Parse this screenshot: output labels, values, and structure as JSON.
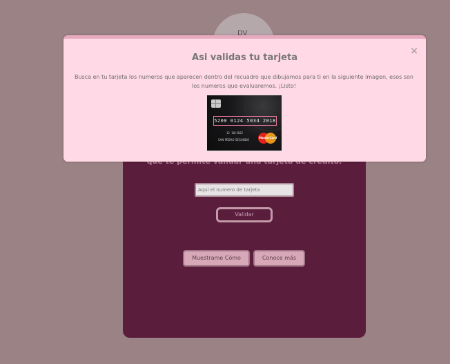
{
  "logo": {
    "text": "DV"
  },
  "background": {
    "tagline": "que te permite validar una tarjeta de crédito.",
    "card_input": {
      "placeholder": "Aqui el numero de tarjeta"
    },
    "validate_label": "Validar",
    "show_me_label": "Muestrame Cómo",
    "learn_more_label": "Conoce más"
  },
  "modal": {
    "title": "Asi validas tu tarjeta",
    "body": "Busca en tu tarjeta los numeros que aparecen dentro del recuadro que dibujamos para ti en la siguiente imagen, esos son los numeros que evaluaremos. ¡Listo!",
    "close_glyph": "×",
    "card": {
      "number": "5200 0124 5034 2018",
      "expiry": "12 10/2022",
      "holder": "SAN PEDRO SEGUNDO",
      "brand": "MasterCard"
    }
  },
  "colors": {
    "page_bg": "#9a8285",
    "panel_bg": "#5a1d3c",
    "modal_bg": "#ffd9e5",
    "button_light": "#d7a8b8"
  }
}
